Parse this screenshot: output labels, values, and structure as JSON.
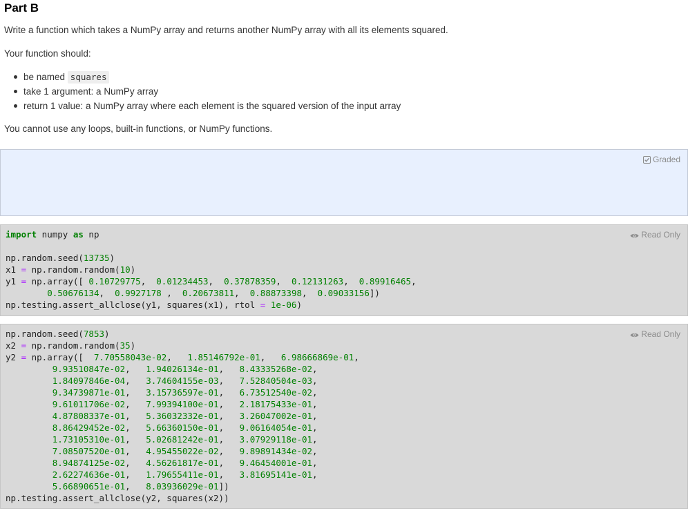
{
  "page": {
    "heading": "Part B",
    "intro": "Write a function which takes a NumPy array and returns another NumPy array with all its elements squared.",
    "requirements_lead": "Your function should:",
    "requirements": [
      {
        "text": "be named ",
        "code": "squares"
      },
      {
        "text": "take 1 argument: a NumPy array"
      },
      {
        "text": "return 1 value: a NumPy array where each element is the squared version of the input array"
      }
    ],
    "constraint": "You cannot use any loops, built-in functions, or NumPy functions."
  },
  "graded_cell": {
    "badge": "Graded",
    "icon": "checkbox-checked-icon"
  },
  "cell1": {
    "badge": "Read Only",
    "icon": "eye-icon",
    "lines": [
      [
        {
          "t": "kw",
          "v": "import"
        },
        {
          "t": "p",
          "v": " numpy "
        },
        {
          "t": "kw",
          "v": "as"
        },
        {
          "t": "p",
          "v": " np"
        }
      ],
      [],
      [
        {
          "t": "p",
          "v": "np.random.seed("
        },
        {
          "t": "num",
          "v": "13735"
        },
        {
          "t": "p",
          "v": ")"
        }
      ],
      [
        {
          "t": "p",
          "v": "x1 "
        },
        {
          "t": "op",
          "v": "="
        },
        {
          "t": "p",
          "v": " np.random.random("
        },
        {
          "t": "num",
          "v": "10"
        },
        {
          "t": "p",
          "v": ")"
        }
      ],
      [
        {
          "t": "p",
          "v": "y1 "
        },
        {
          "t": "op",
          "v": "="
        },
        {
          "t": "p",
          "v": " np.array([ "
        },
        {
          "t": "num",
          "v": "0.10729775"
        },
        {
          "t": "p",
          "v": ",  "
        },
        {
          "t": "num",
          "v": "0.01234453"
        },
        {
          "t": "p",
          "v": ",  "
        },
        {
          "t": "num",
          "v": "0.37878359"
        },
        {
          "t": "p",
          "v": ",  "
        },
        {
          "t": "num",
          "v": "0.12131263"
        },
        {
          "t": "p",
          "v": ",  "
        },
        {
          "t": "num",
          "v": "0.89916465"
        },
        {
          "t": "p",
          "v": ","
        }
      ],
      [
        {
          "t": "p",
          "v": "        "
        },
        {
          "t": "num",
          "v": "0.50676134"
        },
        {
          "t": "p",
          "v": ",  "
        },
        {
          "t": "num",
          "v": "0.9927178"
        },
        {
          "t": "p",
          "v": " ,  "
        },
        {
          "t": "num",
          "v": "0.20673811"
        },
        {
          "t": "p",
          "v": ",  "
        },
        {
          "t": "num",
          "v": "0.88873398"
        },
        {
          "t": "p",
          "v": ",  "
        },
        {
          "t": "num",
          "v": "0.09033156"
        },
        {
          "t": "p",
          "v": "])"
        }
      ],
      [
        {
          "t": "p",
          "v": "np.testing.assert_allclose(y1, squares(x1), rtol "
        },
        {
          "t": "op",
          "v": "="
        },
        {
          "t": "p",
          "v": " "
        },
        {
          "t": "num",
          "v": "1e-06"
        },
        {
          "t": "p",
          "v": ")"
        }
      ]
    ]
  },
  "cell2": {
    "badge": "Read Only",
    "icon": "eye-icon",
    "lines": [
      [
        {
          "t": "p",
          "v": "np.random.seed("
        },
        {
          "t": "num",
          "v": "7853"
        },
        {
          "t": "p",
          "v": ")"
        }
      ],
      [
        {
          "t": "p",
          "v": "x2 "
        },
        {
          "t": "op",
          "v": "="
        },
        {
          "t": "p",
          "v": " np.random.random("
        },
        {
          "t": "num",
          "v": "35"
        },
        {
          "t": "p",
          "v": ")"
        }
      ],
      [
        {
          "t": "p",
          "v": "y2 "
        },
        {
          "t": "op",
          "v": "="
        },
        {
          "t": "p",
          "v": " np.array([  "
        },
        {
          "t": "num",
          "v": "7.70558043e-02"
        },
        {
          "t": "p",
          "v": ",   "
        },
        {
          "t": "num",
          "v": "1.85146792e-01"
        },
        {
          "t": "p",
          "v": ",   "
        },
        {
          "t": "num",
          "v": "6.98666869e-01"
        },
        {
          "t": "p",
          "v": ","
        }
      ],
      [
        {
          "t": "p",
          "v": "         "
        },
        {
          "t": "num",
          "v": "9.93510847e-02"
        },
        {
          "t": "p",
          "v": ",   "
        },
        {
          "t": "num",
          "v": "1.94026134e-01"
        },
        {
          "t": "p",
          "v": ",   "
        },
        {
          "t": "num",
          "v": "8.43335268e-02"
        },
        {
          "t": "p",
          "v": ","
        }
      ],
      [
        {
          "t": "p",
          "v": "         "
        },
        {
          "t": "num",
          "v": "1.84097846e-04"
        },
        {
          "t": "p",
          "v": ",   "
        },
        {
          "t": "num",
          "v": "3.74604155e-03"
        },
        {
          "t": "p",
          "v": ",   "
        },
        {
          "t": "num",
          "v": "7.52840504e-03"
        },
        {
          "t": "p",
          "v": ","
        }
      ],
      [
        {
          "t": "p",
          "v": "         "
        },
        {
          "t": "num",
          "v": "9.34739871e-01"
        },
        {
          "t": "p",
          "v": ",   "
        },
        {
          "t": "num",
          "v": "3.15736597e-01"
        },
        {
          "t": "p",
          "v": ",   "
        },
        {
          "t": "num",
          "v": "6.73512540e-02"
        },
        {
          "t": "p",
          "v": ","
        }
      ],
      [
        {
          "t": "p",
          "v": "         "
        },
        {
          "t": "num",
          "v": "9.61011706e-02"
        },
        {
          "t": "p",
          "v": ",   "
        },
        {
          "t": "num",
          "v": "7.99394100e-01"
        },
        {
          "t": "p",
          "v": ",   "
        },
        {
          "t": "num",
          "v": "2.18175433e-01"
        },
        {
          "t": "p",
          "v": ","
        }
      ],
      [
        {
          "t": "p",
          "v": "         "
        },
        {
          "t": "num",
          "v": "4.87808337e-01"
        },
        {
          "t": "p",
          "v": ",   "
        },
        {
          "t": "num",
          "v": "5.36032332e-01"
        },
        {
          "t": "p",
          "v": ",   "
        },
        {
          "t": "num",
          "v": "3.26047002e-01"
        },
        {
          "t": "p",
          "v": ","
        }
      ],
      [
        {
          "t": "p",
          "v": "         "
        },
        {
          "t": "num",
          "v": "8.86429452e-02"
        },
        {
          "t": "p",
          "v": ",   "
        },
        {
          "t": "num",
          "v": "5.66360150e-01"
        },
        {
          "t": "p",
          "v": ",   "
        },
        {
          "t": "num",
          "v": "9.06164054e-01"
        },
        {
          "t": "p",
          "v": ","
        }
      ],
      [
        {
          "t": "p",
          "v": "         "
        },
        {
          "t": "num",
          "v": "1.73105310e-01"
        },
        {
          "t": "p",
          "v": ",   "
        },
        {
          "t": "num",
          "v": "5.02681242e-01"
        },
        {
          "t": "p",
          "v": ",   "
        },
        {
          "t": "num",
          "v": "3.07929118e-01"
        },
        {
          "t": "p",
          "v": ","
        }
      ],
      [
        {
          "t": "p",
          "v": "         "
        },
        {
          "t": "num",
          "v": "7.08507520e-01"
        },
        {
          "t": "p",
          "v": ",   "
        },
        {
          "t": "num",
          "v": "4.95455022e-02"
        },
        {
          "t": "p",
          "v": ",   "
        },
        {
          "t": "num",
          "v": "9.89891434e-02"
        },
        {
          "t": "p",
          "v": ","
        }
      ],
      [
        {
          "t": "p",
          "v": "         "
        },
        {
          "t": "num",
          "v": "8.94874125e-02"
        },
        {
          "t": "p",
          "v": ",   "
        },
        {
          "t": "num",
          "v": "4.56261817e-01"
        },
        {
          "t": "p",
          "v": ",   "
        },
        {
          "t": "num",
          "v": "9.46454001e-01"
        },
        {
          "t": "p",
          "v": ","
        }
      ],
      [
        {
          "t": "p",
          "v": "         "
        },
        {
          "t": "num",
          "v": "2.62274636e-01"
        },
        {
          "t": "p",
          "v": ",   "
        },
        {
          "t": "num",
          "v": "1.79655411e-01"
        },
        {
          "t": "p",
          "v": ",   "
        },
        {
          "t": "num",
          "v": "3.81695141e-01"
        },
        {
          "t": "p",
          "v": ","
        }
      ],
      [
        {
          "t": "p",
          "v": "         "
        },
        {
          "t": "num",
          "v": "5.66890651e-01"
        },
        {
          "t": "p",
          "v": ",   "
        },
        {
          "t": "num",
          "v": "8.03936029e-01"
        },
        {
          "t": "p",
          "v": "])"
        }
      ],
      [
        {
          "t": "p",
          "v": "np.testing.assert_allclose(y2, squares(x2))"
        }
      ]
    ]
  }
}
